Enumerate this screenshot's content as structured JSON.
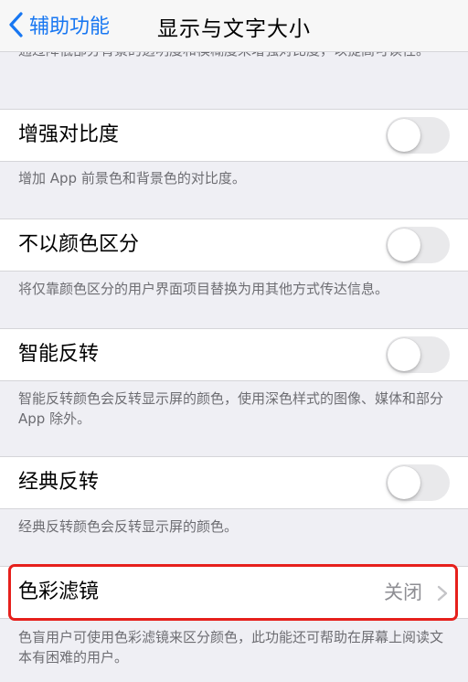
{
  "nav": {
    "back_label": "辅助功能",
    "title": "显示与文字大小"
  },
  "partial_footer": "通过降低部分背景的透明度和模糊度来增强对比度，以提高可读性。",
  "rows": [
    {
      "label": "增强对比度",
      "enabled": false,
      "footer": "增加 App 前景色和背景色的对比度。"
    },
    {
      "label": "不以颜色区分",
      "enabled": false,
      "footer": "将仅靠颜色区分的用户界面项目替换为用其他方式传达信息。"
    },
    {
      "label": "智能反转",
      "enabled": false,
      "footer": "智能反转颜色会反转显示屏的颜色，使用深色样式的图像、媒体和部分 App 除外。"
    },
    {
      "label": "经典反转",
      "enabled": false,
      "footer": "经典反转颜色会反转显示屏的颜色。"
    }
  ],
  "color_filters": {
    "label": "色彩滤镜",
    "value": "关闭",
    "footer": "色盲用户可使用色彩滤镜来区分颜色，此功能还可帮助在屏幕上阅读文本有困难的用户。"
  },
  "colors": {
    "accent": "#1877f2",
    "highlight": "#e6201c",
    "toggle_off": "#e9e9eb"
  }
}
